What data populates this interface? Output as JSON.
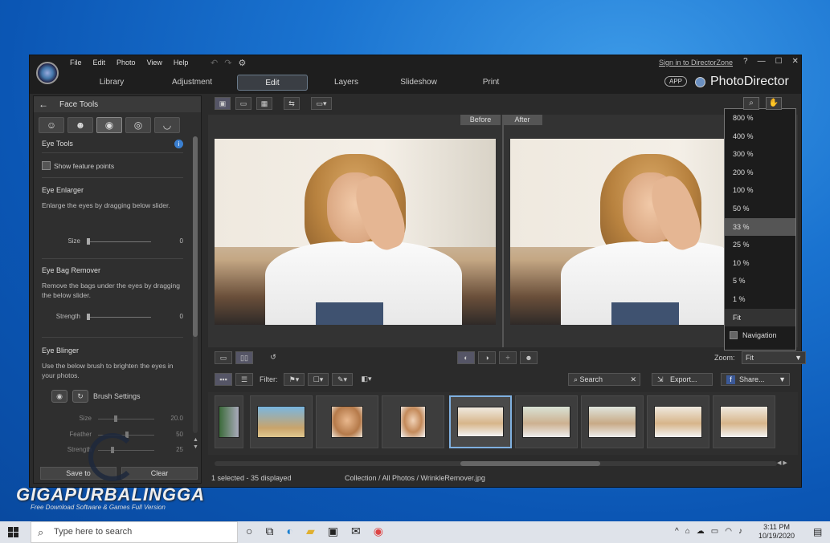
{
  "menu": [
    "File",
    "Edit",
    "Photo",
    "View",
    "Help"
  ],
  "modes": [
    "Library",
    "Adjustment",
    "Edit",
    "Layers",
    "Slideshow",
    "Print"
  ],
  "active_mode": "Edit",
  "sign_in": "Sign in to DirectorZone",
  "win_controls": [
    "?",
    "—",
    "☐",
    "✕"
  ],
  "app_badge": "APP",
  "brand": "PhotoDirector",
  "left_panel": {
    "title": "Face Tools",
    "back_icon": "←",
    "tool_icons": [
      "☺",
      "☻",
      "◉",
      "◎",
      "◡"
    ],
    "eye_tools": "Eye Tools",
    "info_icon": "i",
    "show_feature_points": "Show feature points",
    "eye_enlarger": {
      "title": "Eye Enlarger",
      "desc": "Enlarge the eyes by dragging below slider.",
      "slider_label": "Size",
      "value": "0"
    },
    "eye_bag": {
      "title": "Eye Bag Remover",
      "desc": "Remove the bags under the eyes by dragging the below slider.",
      "slider_label": "Strength",
      "value": "0"
    },
    "eye_blinger": {
      "title": "Eye Blinger",
      "desc": "Use the below brush to brighten the eyes in your photos.",
      "brush_settings": "Brush Settings",
      "sliders": [
        {
          "label": "Size",
          "value": "20.0"
        },
        {
          "label": "Feather",
          "value": "50"
        },
        {
          "label": "Strength",
          "value": "25"
        }
      ]
    },
    "save_button": "Save to",
    "clear_button": "Clear"
  },
  "viewer": {
    "before": "Before",
    "after": "After"
  },
  "zoom_menu": {
    "items": [
      "800 %",
      "400 %",
      "300 %",
      "200 %",
      "100 %",
      "50 %",
      "33 %",
      "25 %",
      "10 %",
      "5 %",
      "1 %",
      "Fit"
    ],
    "selected": "33 %",
    "navigation": "Navigation"
  },
  "controls": {
    "zoom_label": "Zoom:",
    "zoom_value": "Fit"
  },
  "filter_bar": {
    "filter_label": "Filter:",
    "search": "Search",
    "export": "Export...",
    "share": "Share..."
  },
  "status": {
    "left": "1 selected - 35 displayed",
    "path": "Collection / All Photos / WrinkleRemover.jpg"
  },
  "watermark": {
    "title": "GIGAPURBALINGGA",
    "subtitle": "Free Download Software & Games Full Version"
  },
  "taskbar": {
    "search_placeholder": "Type here to search",
    "time": "3:11 PM",
    "date": "10/19/2020"
  }
}
